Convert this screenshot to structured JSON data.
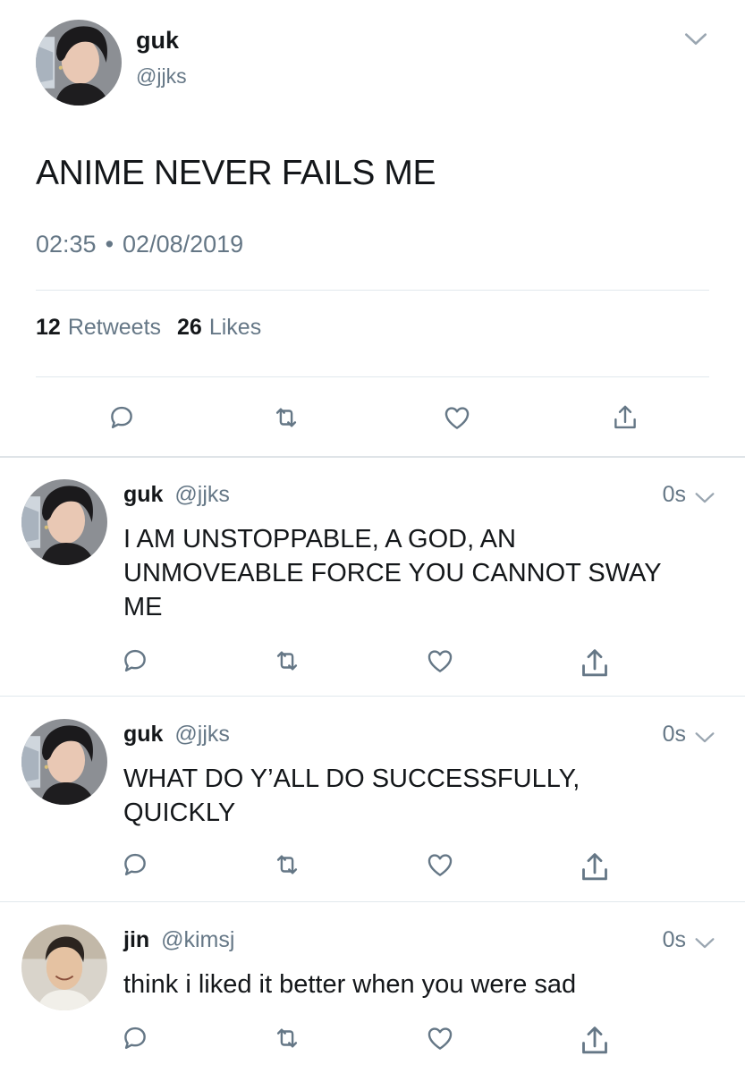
{
  "main_tweet": {
    "author_name": "guk",
    "author_handle": "@jjks",
    "text": "ANIME NEVER FAILS ME",
    "time": "02:35",
    "separator": "•",
    "date": "02/08/2019",
    "retweet_count": "12",
    "retweet_label": "Retweets",
    "like_count": "26",
    "like_label": "Likes"
  },
  "replies": [
    {
      "author_name": "guk",
      "author_handle": "@jjks",
      "time": "0s",
      "text_lines": [
        "I AM UNSTOPPABLE, A GOD, AN",
        "UNMOVEABLE FORCE YOU CANNOT SWAY",
        "ME"
      ]
    },
    {
      "author_name": "guk",
      "author_handle": "@jjks",
      "time": "0s",
      "text_lines": [
        "WHAT DO Y’ALL DO SUCCESSFULLY,",
        "QUICKLY"
      ]
    },
    {
      "author_name": "jin",
      "author_handle": "@kimsj",
      "time": "0s",
      "text_lines": [
        "think i liked it better when you were sad"
      ]
    }
  ],
  "icons": {
    "reply": "reply-icon",
    "retweet": "retweet-icon",
    "like": "heart-icon",
    "share": "share-icon",
    "menu": "chevron-down-icon"
  },
  "colors": {
    "text": "#14171a",
    "secondary": "#657786",
    "icon": "#657786",
    "divider": "#e1e8ed"
  }
}
